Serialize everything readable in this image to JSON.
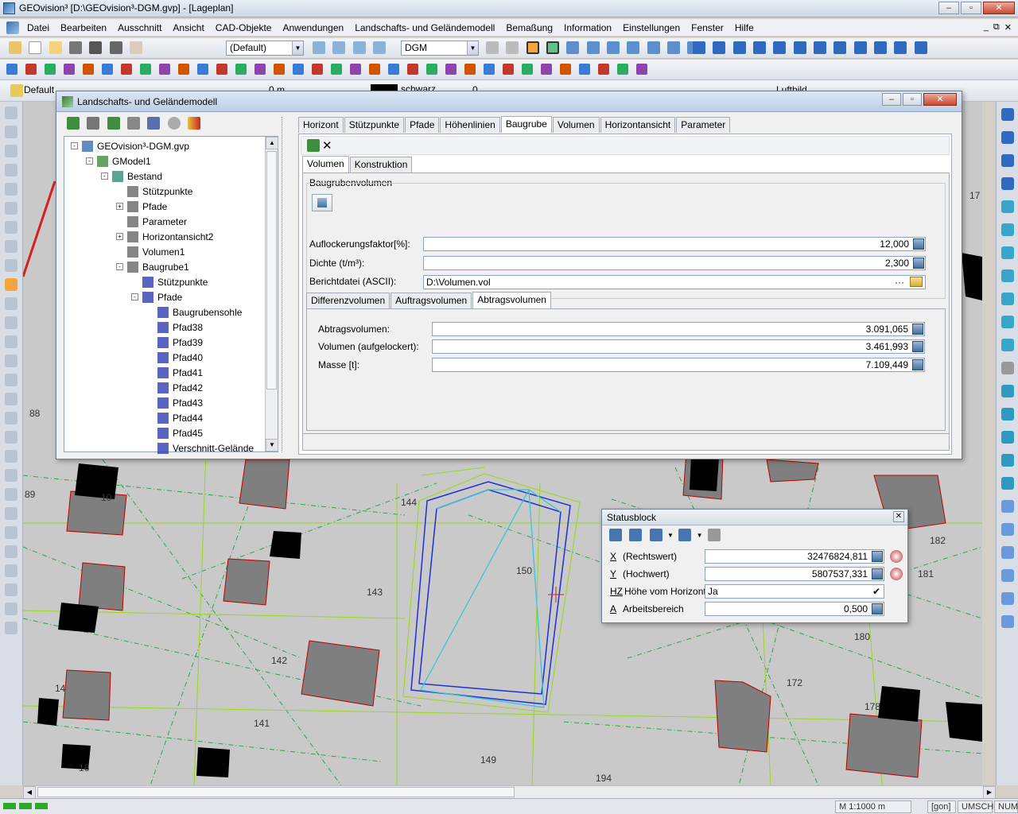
{
  "app": {
    "title": "GEOvision³  [D:\\GEOvision³-DGM.gvp] - [Lageplan]"
  },
  "menu": [
    "Datei",
    "Bearbeiten",
    "Ausschnitt",
    "Ansicht",
    "CAD-Objekte",
    "Anwendungen",
    "Landschafts- und Geländemodell",
    "Bemaßung",
    "Information",
    "Einstellungen",
    "Fenster",
    "Hilfe"
  ],
  "toolbar": {
    "style_combo": "(Default)",
    "layer_combo": "DGM",
    "row3_label": "Default",
    "row3_value": "0 m",
    "row3_color": "schwarz",
    "row3_num": "0",
    "row3_right": "Luftbild"
  },
  "dialog": {
    "title": "Landschafts- und Geländemodell",
    "tree": [
      {
        "label": "GEOvision³-DGM.gvp",
        "depth": 0,
        "toggle": "-"
      },
      {
        "label": "GModel1",
        "depth": 1,
        "toggle": "-"
      },
      {
        "label": "Bestand",
        "depth": 2,
        "toggle": "-"
      },
      {
        "label": "Stützpunkte",
        "depth": 3,
        "toggle": ""
      },
      {
        "label": "Pfade",
        "depth": 3,
        "toggle": "+"
      },
      {
        "label": "Parameter",
        "depth": 3,
        "toggle": ""
      },
      {
        "label": "Horizontansicht2",
        "depth": 3,
        "toggle": "+"
      },
      {
        "label": "Volumen1",
        "depth": 3,
        "toggle": ""
      },
      {
        "label": "Baugrube1",
        "depth": 3,
        "toggle": "-"
      },
      {
        "label": "Stützpunkte",
        "depth": 4,
        "toggle": ""
      },
      {
        "label": "Pfade",
        "depth": 4,
        "toggle": "-"
      },
      {
        "label": "Baugrubensohle",
        "depth": 5,
        "toggle": ""
      },
      {
        "label": "Pfad38",
        "depth": 5,
        "toggle": ""
      },
      {
        "label": "Pfad39",
        "depth": 5,
        "toggle": ""
      },
      {
        "label": "Pfad40",
        "depth": 5,
        "toggle": ""
      },
      {
        "label": "Pfad41",
        "depth": 5,
        "toggle": ""
      },
      {
        "label": "Pfad42",
        "depth": 5,
        "toggle": ""
      },
      {
        "label": "Pfad43",
        "depth": 5,
        "toggle": ""
      },
      {
        "label": "Pfad44",
        "depth": 5,
        "toggle": ""
      },
      {
        "label": "Pfad45",
        "depth": 5,
        "toggle": ""
      },
      {
        "label": "Verschnitt-Gelände",
        "depth": 5,
        "toggle": ""
      }
    ],
    "main_tabs": [
      "Horizont",
      "Stützpunkte",
      "Pfade",
      "Höhenlinien",
      "Baugrube",
      "Volumen",
      "Horizontansicht",
      "Parameter"
    ],
    "active_main_tab": "Baugrube",
    "sub_tabs": [
      "Volumen",
      "Konstruktion"
    ],
    "group_label": "Baugrubenvolumen",
    "fields": {
      "auflockerung_label": "Auflockerungsfaktor[%]:",
      "auflockerung_value": "12,000",
      "dichte_label": "Dichte (t/m³):",
      "dichte_value": "2,300",
      "bericht_label": "Berichtdatei (ASCII):",
      "bericht_value": "D:\\Volumen.vol",
      "bericht_dots": "···"
    },
    "result_tabs": [
      "Differenzvolumen",
      "Auftragsvolumen",
      "Abtragsvolumen"
    ],
    "results": {
      "abtrag_label": "Abtragsvolumen:",
      "abtrag_value": "3.091,065",
      "aufgelockert_label": "Volumen (aufgelockert):",
      "aufgelockert_value": "3.461,993",
      "masse_label": "Masse [t]:",
      "masse_value": "7.109,449"
    }
  },
  "statusblock": {
    "title": "Statusblock",
    "rows": [
      {
        "key": "X",
        "label": "(Rechtswert)",
        "value": "32476824,811"
      },
      {
        "key": "Y",
        "label": "(Hochwert)",
        "value": "5807537,331"
      },
      {
        "key": "HZ",
        "label": "Höhe vom Horizont",
        "value": "Ja"
      },
      {
        "key": "A",
        "label": "Arbeitsbereich",
        "value": "0,500"
      }
    ]
  },
  "map_labels": [
    "150",
    "143",
    "144",
    "142",
    "141",
    "149",
    "194",
    "180",
    "172",
    "178",
    "181",
    "182",
    "89",
    "88",
    "17",
    "10",
    "16",
    "14"
  ],
  "statusbar": {
    "scale": "M 1:1000  m",
    "unit": "[gon]",
    "caps": "UMSCH",
    "num": "NUM"
  },
  "colors": {
    "canvas": "#c9c9c9",
    "building": "#7f7f7f",
    "accent_blue": "#1f2fd6",
    "accent_cyan": "#39c6d6",
    "parcel": "#9ad61a"
  }
}
